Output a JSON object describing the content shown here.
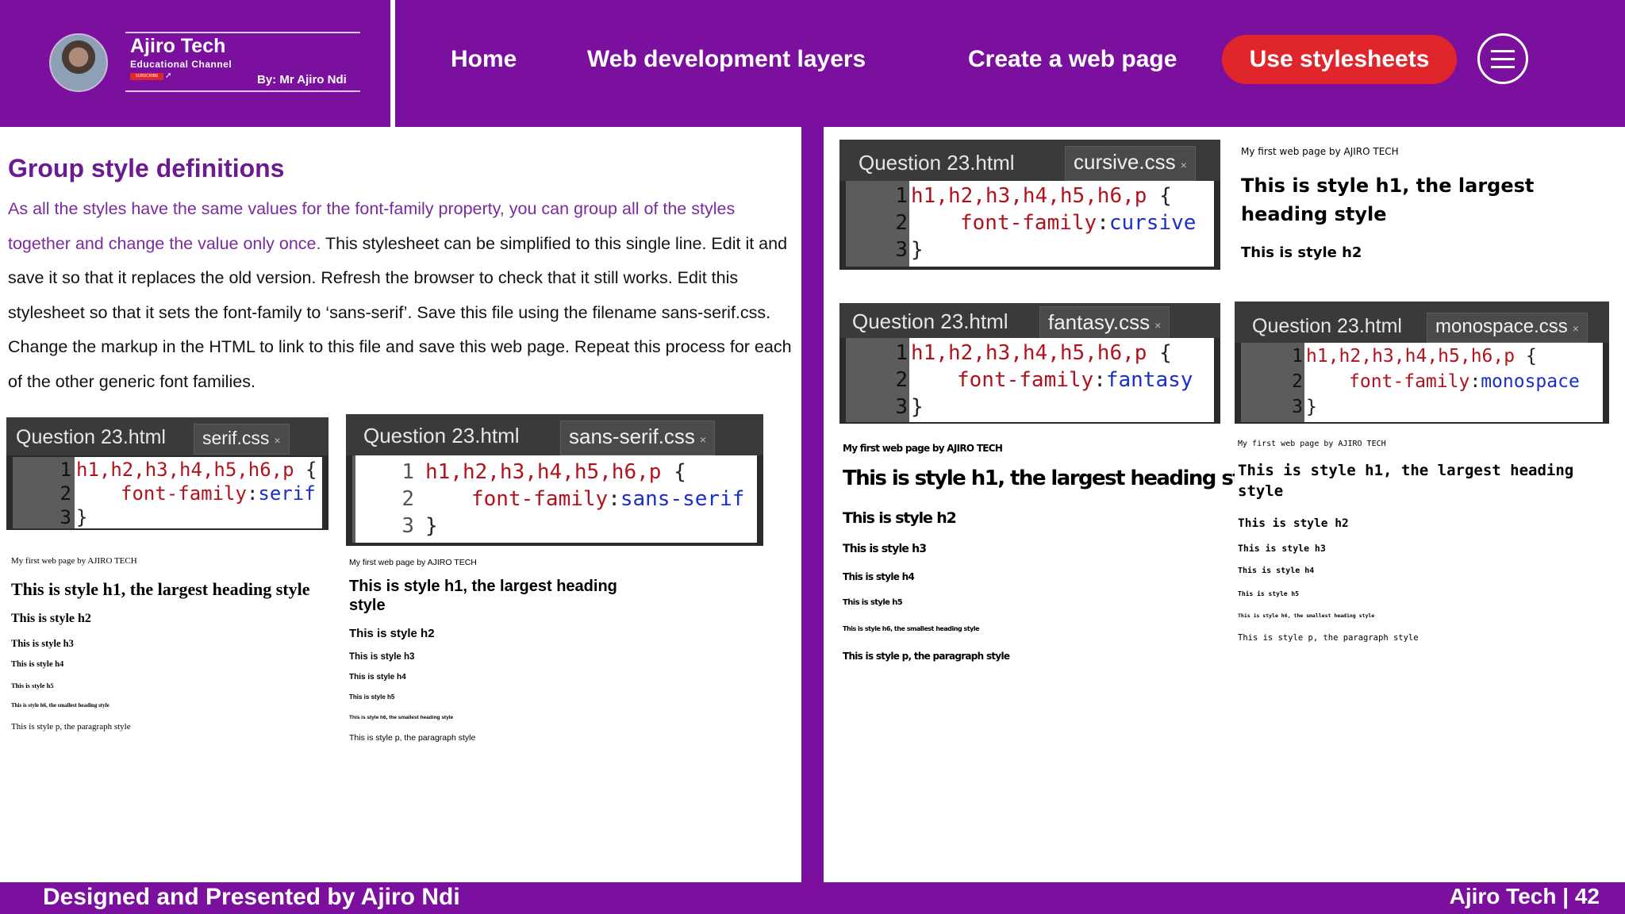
{
  "brand": {
    "name": "Ajiro Tech",
    "subtitle": "Educational Channel",
    "subscribe": "SUBSCRIBE",
    "byline": "By: Mr Ajiro Ndi"
  },
  "nav": {
    "home": "Home",
    "layers": "Web development layers",
    "create": "Create a web page",
    "active": "Use stylesheets"
  },
  "left": {
    "title": "Group style definitions",
    "para_highlight": "As all the styles have the same values for the font-family property, you can group all of the styles together and change the value only once.",
    "para_rest": " This stylesheet can be simplified to this single line. Edit it and save it so that it replaces the old version. Refresh the browser to check that it still works. Edit this stylesheet so that it sets the font-family to ‘sans-serif’. Save this file using the filename sans-serif.css. Change the markup in the HTML to link to this file and save this web page. Repeat this process for each of the other generic font families."
  },
  "editors": {
    "serif": {
      "tab1": "Question 23.html",
      "tab2": "serif.css",
      "value": "serif"
    },
    "sans": {
      "tab1": "Question 23.html",
      "tab2": "sans-serif.css",
      "value": "sans-serif"
    },
    "cursive": {
      "tab1": "Question 23.html",
      "tab2": "cursive.css",
      "value": "cursive"
    },
    "fantasy": {
      "tab1": "Question 23.html",
      "tab2": "fantasy.css",
      "value": "fantasy"
    },
    "mono": {
      "tab1": "Question 23.html",
      "tab2": "monospace.css",
      "value": "monospace"
    }
  },
  "code": {
    "n1": "1",
    "n2": "2",
    "n3": "3",
    "selectors": "h1,h2,h3,h4,h5,h6,p",
    "brace_open": "{",
    "property": "font-family",
    "colon": ":",
    "brace_close": "}",
    "close_x": "×"
  },
  "output": {
    "caption": "My first web page by AJIRO TECH",
    "h1": "This is style h1, the largest heading style",
    "h2": "This is style h2",
    "h3": "This is style h3",
    "h4": "This is style h4",
    "h5": "This is style h5",
    "h6": "This is style h6, the smallest heading style",
    "p": "This is style p, the paragraph style"
  },
  "footer": {
    "left": "Designed and Presented by Ajiro Ndi",
    "right": "Ajiro Tech | 42"
  }
}
